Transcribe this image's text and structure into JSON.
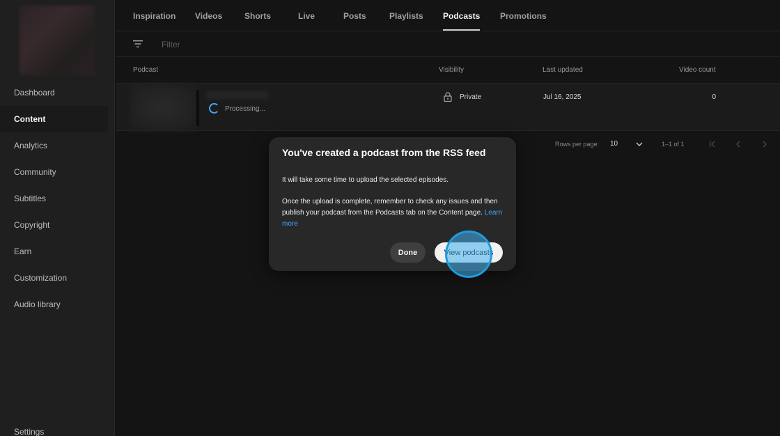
{
  "sidebar": {
    "items": [
      {
        "label": "Dashboard"
      },
      {
        "label": "Content"
      },
      {
        "label": "Analytics"
      },
      {
        "label": "Community"
      },
      {
        "label": "Subtitles"
      },
      {
        "label": "Copyright"
      },
      {
        "label": "Earn"
      },
      {
        "label": "Customization"
      },
      {
        "label": "Audio library"
      }
    ],
    "active_item": "Content",
    "settings_label": "Settings"
  },
  "tabs": {
    "items": [
      {
        "label": "Inspiration"
      },
      {
        "label": "Videos"
      },
      {
        "label": "Shorts"
      },
      {
        "label": "Live"
      },
      {
        "label": "Posts"
      },
      {
        "label": "Playlists"
      },
      {
        "label": "Podcasts"
      },
      {
        "label": "Promotions"
      }
    ],
    "active": "Podcasts"
  },
  "filter": {
    "placeholder": "Filter"
  },
  "table": {
    "headers": {
      "podcast": "Podcast",
      "visibility": "Visibility",
      "last_updated": "Last updated",
      "video_count": "Video count"
    },
    "rows": [
      {
        "status": "Processing...",
        "visibility": "Private",
        "last_updated": "Jul 16, 2025",
        "video_count": "0"
      }
    ]
  },
  "pagination": {
    "rows_per_page_label": "Rows per page:",
    "rows_per_page": "10",
    "range": "1–1 of 1"
  },
  "dialog": {
    "title": "You've created a podcast from the RSS feed",
    "paragraph1": "It will take some time to upload the selected episodes.",
    "paragraph2": "Once the upload is complete, remember to check any issues and then publish your podcast from the Podcasts tab on the Content page.",
    "learn_more": "Learn more",
    "done_label": "Done",
    "view_label": "View podcasts"
  },
  "colors": {
    "accent": "#3ea6ff",
    "background": "#0f0f0f",
    "dialog": "#282828"
  }
}
